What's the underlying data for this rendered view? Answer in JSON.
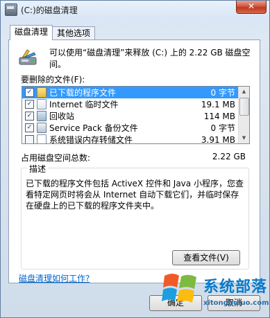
{
  "window": {
    "title": "(C:)的磁盘清理",
    "close_label": "✕"
  },
  "tabs": [
    {
      "label": "磁盘清理"
    },
    {
      "label": "其他选项"
    }
  ],
  "intro": {
    "text": "可以使用“磁盘清理”来释放  (C:) 上的 2.22 GB 磁盘空间。"
  },
  "files_label": "要删除的文件(F):",
  "files": [
    {
      "label": "已下载的程序文件",
      "size": "0 字节",
      "checked": true,
      "selected": true,
      "icon": "folder-icon"
    },
    {
      "label": "Internet 临时文件",
      "size": "19.1 MB",
      "checked": true,
      "selected": false,
      "icon": "internet-file-icon"
    },
    {
      "label": "回收站",
      "size": "114 MB",
      "checked": true,
      "selected": false,
      "icon": "recycle-bin-icon"
    },
    {
      "label": "Service Pack 备份文件",
      "size": "0 字节",
      "checked": true,
      "selected": false,
      "icon": "backup-file-icon"
    },
    {
      "label": "系统错误内存转储文件",
      "size": "3.91 MB",
      "checked": false,
      "selected": false,
      "icon": "file-icon"
    }
  ],
  "total": {
    "label": "占用磁盘空间总数:",
    "value": "2.22 GB"
  },
  "description": {
    "title": "描述",
    "text": "已下载的程序文件包括 ActiveX 控件和 Java 小程序，您查看特定网页时将会从 Internet 自动下载它们，并临时保存在硬盘上的已下载的程序文件夹中。",
    "view_button": "查看文件(V)"
  },
  "help_link": "磁盘清理如何工作?",
  "buttons": {
    "ok": "确定",
    "cancel": "取消"
  },
  "watermark": {
    "title": "系统部落",
    "url": "xitongbuluo.com"
  },
  "colors": {
    "selection": "#3399ff",
    "link": "#0066cc",
    "watermark": "#0b7ac9"
  }
}
